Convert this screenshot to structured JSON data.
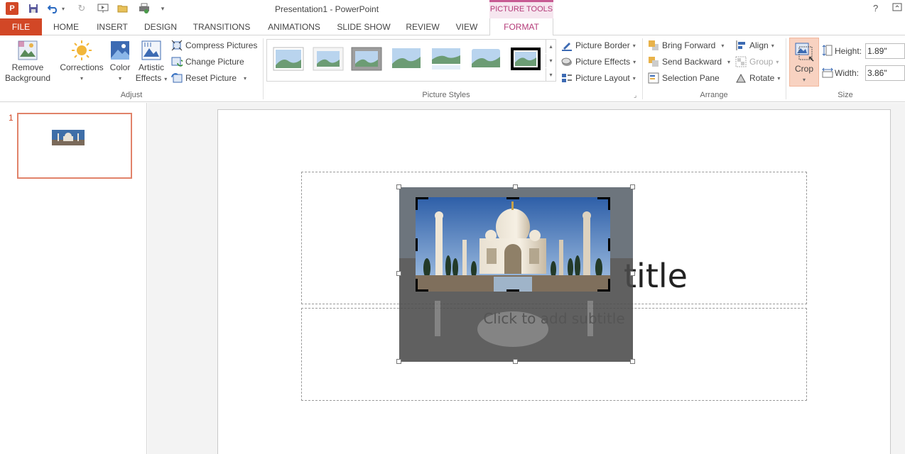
{
  "window": {
    "title": "Presentation1 - PowerPoint",
    "contextual_tab": "PICTURE TOOLS",
    "help": "?"
  },
  "tabs": [
    {
      "label": "FILE"
    },
    {
      "label": "HOME"
    },
    {
      "label": "INSERT"
    },
    {
      "label": "DESIGN"
    },
    {
      "label": "TRANSITIONS"
    },
    {
      "label": "ANIMATIONS"
    },
    {
      "label": "SLIDE SHOW"
    },
    {
      "label": "REVIEW"
    },
    {
      "label": "VIEW"
    },
    {
      "label": "FORMAT"
    }
  ],
  "ribbon": {
    "adjust": {
      "remove_background_1": "Remove",
      "remove_background_2": "Background",
      "corrections": "Corrections",
      "color": "Color",
      "artistic_1": "Artistic",
      "artistic_2": "Effects",
      "compress": "Compress Pictures",
      "change": "Change Picture",
      "reset": "Reset Picture",
      "label": "Adjust"
    },
    "styles": {
      "label": "Picture Styles",
      "border": "Picture Border",
      "effects": "Picture Effects",
      "layout": "Picture Layout"
    },
    "arrange": {
      "label": "Arrange",
      "bring_forward": "Bring Forward",
      "send_backward": "Send Backward",
      "selection_pane": "Selection Pane",
      "align": "Align",
      "group": "Group",
      "rotate": "Rotate"
    },
    "size": {
      "label": "Size",
      "crop": "Crop",
      "height_label": "Height:",
      "height_value": "1.89\"",
      "width_label": "Width:",
      "width_value": "3.86\""
    }
  },
  "thumbnails": {
    "slide_number": "1"
  },
  "slide": {
    "title_visible": "title",
    "subtitle_placeholder": "Click to add subtitle"
  },
  "colors": {
    "accent": "#d24726",
    "contextual": "#b43a78",
    "crop_active": "#f8d2c1"
  }
}
